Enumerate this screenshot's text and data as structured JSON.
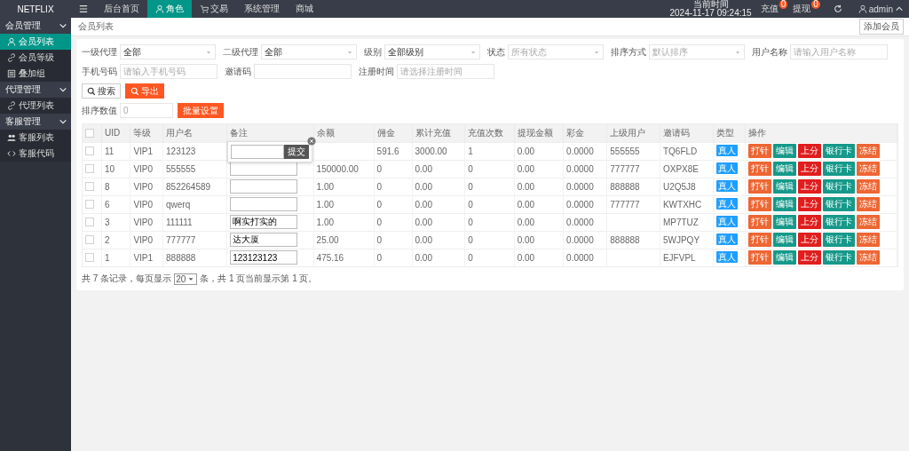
{
  "topbar": {
    "logo": "NETFLIX",
    "nav": [
      {
        "label": "后台首页",
        "selected": false
      },
      {
        "label": "角色",
        "selected": true
      },
      {
        "label": "交易",
        "selected": false
      },
      {
        "label": "系统管理",
        "selected": false
      },
      {
        "label": "商城",
        "selected": false
      }
    ],
    "time_label": "当前时间",
    "time": "2024-11-17 09:24:15",
    "alerts": [
      {
        "label": "充值",
        "count": "0"
      },
      {
        "label": "提现",
        "count": "0"
      }
    ],
    "user": "admin"
  },
  "sidebar": [
    {
      "label": "会员管理",
      "expanded": true,
      "children": [
        {
          "label": "会员列表",
          "selected": true
        },
        {
          "label": "会员等级",
          "selected": false
        },
        {
          "label": "叠加组",
          "selected": false
        }
      ]
    },
    {
      "label": "代理管理",
      "expanded": true,
      "children": [
        {
          "label": "代理列表",
          "selected": false
        }
      ]
    },
    {
      "label": "客服管理",
      "expanded": true,
      "children": [
        {
          "label": "客服列表",
          "selected": false
        },
        {
          "label": "客服代码",
          "selected": false
        }
      ]
    }
  ],
  "breadcrumb": "会员列表",
  "add_button": "添加会员",
  "filters": [
    {
      "kind": "select",
      "label": "一级代理",
      "value": "全部"
    },
    {
      "kind": "select",
      "label": "二级代理",
      "value": "全部"
    },
    {
      "kind": "select",
      "label": "级别",
      "value": "全部级别"
    },
    {
      "kind": "select",
      "label": "状态",
      "placeholder": "所有状态"
    },
    {
      "kind": "select",
      "label": "排序方式",
      "placeholder": "默认排序"
    },
    {
      "kind": "input",
      "label": "用户名称",
      "placeholder": "请输入用户名称"
    },
    {
      "kind": "input",
      "label": "手机号码",
      "placeholder": "请输入手机号码"
    },
    {
      "kind": "input",
      "label": "邀请码"
    },
    {
      "kind": "input",
      "label": "注册时间",
      "placeholder": "请选择注册时间"
    }
  ],
  "search_button": "搜索",
  "export_button": "导出",
  "batch": {
    "label": "排序数值",
    "placeholder": "0",
    "button": "批量设置"
  },
  "table": {
    "all_checked": false,
    "columns": [
      "UID",
      "等级",
      "用户名",
      "备注",
      "余额",
      "佣金",
      "累计充值",
      "充值次数",
      "提现金额",
      "彩金",
      "上级用户",
      "邀请码",
      "类型",
      "操作"
    ],
    "rows": [
      {
        "checked": false,
        "uid": "11",
        "level": "VIP1",
        "username": "123123",
        "editing": true,
        "commission": "591.6",
        "recharge_total": "3000.00",
        "recharge_count": "1",
        "withdraw": "0.00",
        "bonus": "0.0000",
        "parent": "555555",
        "invite": "TQ6FLD",
        "type": "真人",
        "actions": [
          {
            "label": "打针",
            "color": "#ee6633"
          },
          {
            "label": "编辑",
            "color": "#16998a"
          },
          {
            "label": "上分",
            "color": "#e01e1e"
          },
          {
            "label": "银行卡",
            "color": "#16998a"
          },
          {
            "label": "冻结",
            "color": "#ee6633"
          }
        ]
      },
      {
        "checked": false,
        "uid": "10",
        "level": "VIP0",
        "username": "555555",
        "editing": false,
        "balance": "150000.00",
        "commission": "0",
        "recharge_total": "0.00",
        "recharge_count": "0",
        "withdraw": "0.00",
        "bonus": "0.0000",
        "parent": "777777",
        "invite": "OXPX8E",
        "type": "真人",
        "actions": [
          {
            "label": "打针",
            "color": "#ee6633"
          },
          {
            "label": "编辑",
            "color": "#16998a"
          },
          {
            "label": "上分",
            "color": "#e01e1e"
          },
          {
            "label": "银行卡",
            "color": "#16998a"
          },
          {
            "label": "冻结",
            "color": "#ee6633"
          }
        ]
      },
      {
        "checked": false,
        "uid": "8",
        "level": "VIP0",
        "username": "852264589",
        "editing": false,
        "balance": "1.00",
        "commission": "0",
        "recharge_total": "0.00",
        "recharge_count": "0",
        "withdraw": "0.00",
        "bonus": "0.0000",
        "parent": "888888",
        "invite": "U2Q5J8",
        "type": "真人",
        "actions": [
          {
            "label": "打针",
            "color": "#ee6633"
          },
          {
            "label": "编辑",
            "color": "#16998a"
          },
          {
            "label": "上分",
            "color": "#e01e1e"
          },
          {
            "label": "银行卡",
            "color": "#16998a"
          },
          {
            "label": "冻结",
            "color": "#ee6633"
          }
        ]
      },
      {
        "checked": false,
        "uid": "6",
        "level": "VIP0",
        "username": "qwerq",
        "editing": false,
        "balance": "1.00",
        "commission": "0",
        "recharge_total": "0.00",
        "recharge_count": "0",
        "withdraw": "0.00",
        "bonus": "0.0000",
        "parent": "777777",
        "invite": "KWTXHC",
        "type": "真人",
        "actions": [
          {
            "label": "打针",
            "color": "#ee6633"
          },
          {
            "label": "编辑",
            "color": "#16998a"
          },
          {
            "label": "上分",
            "color": "#e01e1e"
          },
          {
            "label": "银行卡",
            "color": "#16998a"
          },
          {
            "label": "冻结",
            "color": "#ee6633"
          }
        ]
      },
      {
        "checked": false,
        "uid": "3",
        "level": "VIP0",
        "username": "111111",
        "remark": "啊实打实的",
        "editing": false,
        "balance": "1.00",
        "commission": "0",
        "recharge_total": "0.00",
        "recharge_count": "0",
        "withdraw": "0.00",
        "bonus": "0.0000",
        "invite": "MP7TUZ",
        "type": "真人",
        "actions": [
          {
            "label": "打针",
            "color": "#ee6633"
          },
          {
            "label": "编辑",
            "color": "#16998a"
          },
          {
            "label": "上分",
            "color": "#e01e1e"
          },
          {
            "label": "银行卡",
            "color": "#16998a"
          },
          {
            "label": "冻结",
            "color": "#ee6633"
          }
        ]
      },
      {
        "checked": false,
        "uid": "2",
        "level": "VIP0",
        "username": "777777",
        "remark": "达大厦",
        "editing": false,
        "balance": "25.00",
        "commission": "0",
        "recharge_total": "0.00",
        "recharge_count": "0",
        "withdraw": "0.00",
        "bonus": "0.0000",
        "parent": "888888",
        "invite": "5WJPQY",
        "type": "真人",
        "actions": [
          {
            "label": "打针",
            "color": "#ee6633"
          },
          {
            "label": "编辑",
            "color": "#16998a"
          },
          {
            "label": "上分",
            "color": "#e01e1e"
          },
          {
            "label": "银行卡",
            "color": "#16998a"
          },
          {
            "label": "冻结",
            "color": "#ee6633"
          }
        ]
      },
      {
        "checked": false,
        "uid": "1",
        "level": "VIP1",
        "username": "888888",
        "remark": "123123123",
        "editing": false,
        "balance": "475.16",
        "commission": "0",
        "recharge_total": "0.00",
        "recharge_count": "0",
        "withdraw": "0.00",
        "bonus": "0.0000",
        "invite": "EJFVPL",
        "type": "真人",
        "actions": [
          {
            "label": "打针",
            "color": "#ee6633"
          },
          {
            "label": "编辑",
            "color": "#16998a"
          },
          {
            "label": "上分",
            "color": "#e01e1e"
          },
          {
            "label": "银行卡",
            "color": "#16998a"
          },
          {
            "label": "冻结",
            "color": "#ee6633"
          }
        ]
      }
    ],
    "popup_button": "提交"
  },
  "pager": {
    "before": "共 7 条记录，每页显示",
    "page_size": "20",
    "after": "条，共 1 页当前显示第 1 页。"
  }
}
